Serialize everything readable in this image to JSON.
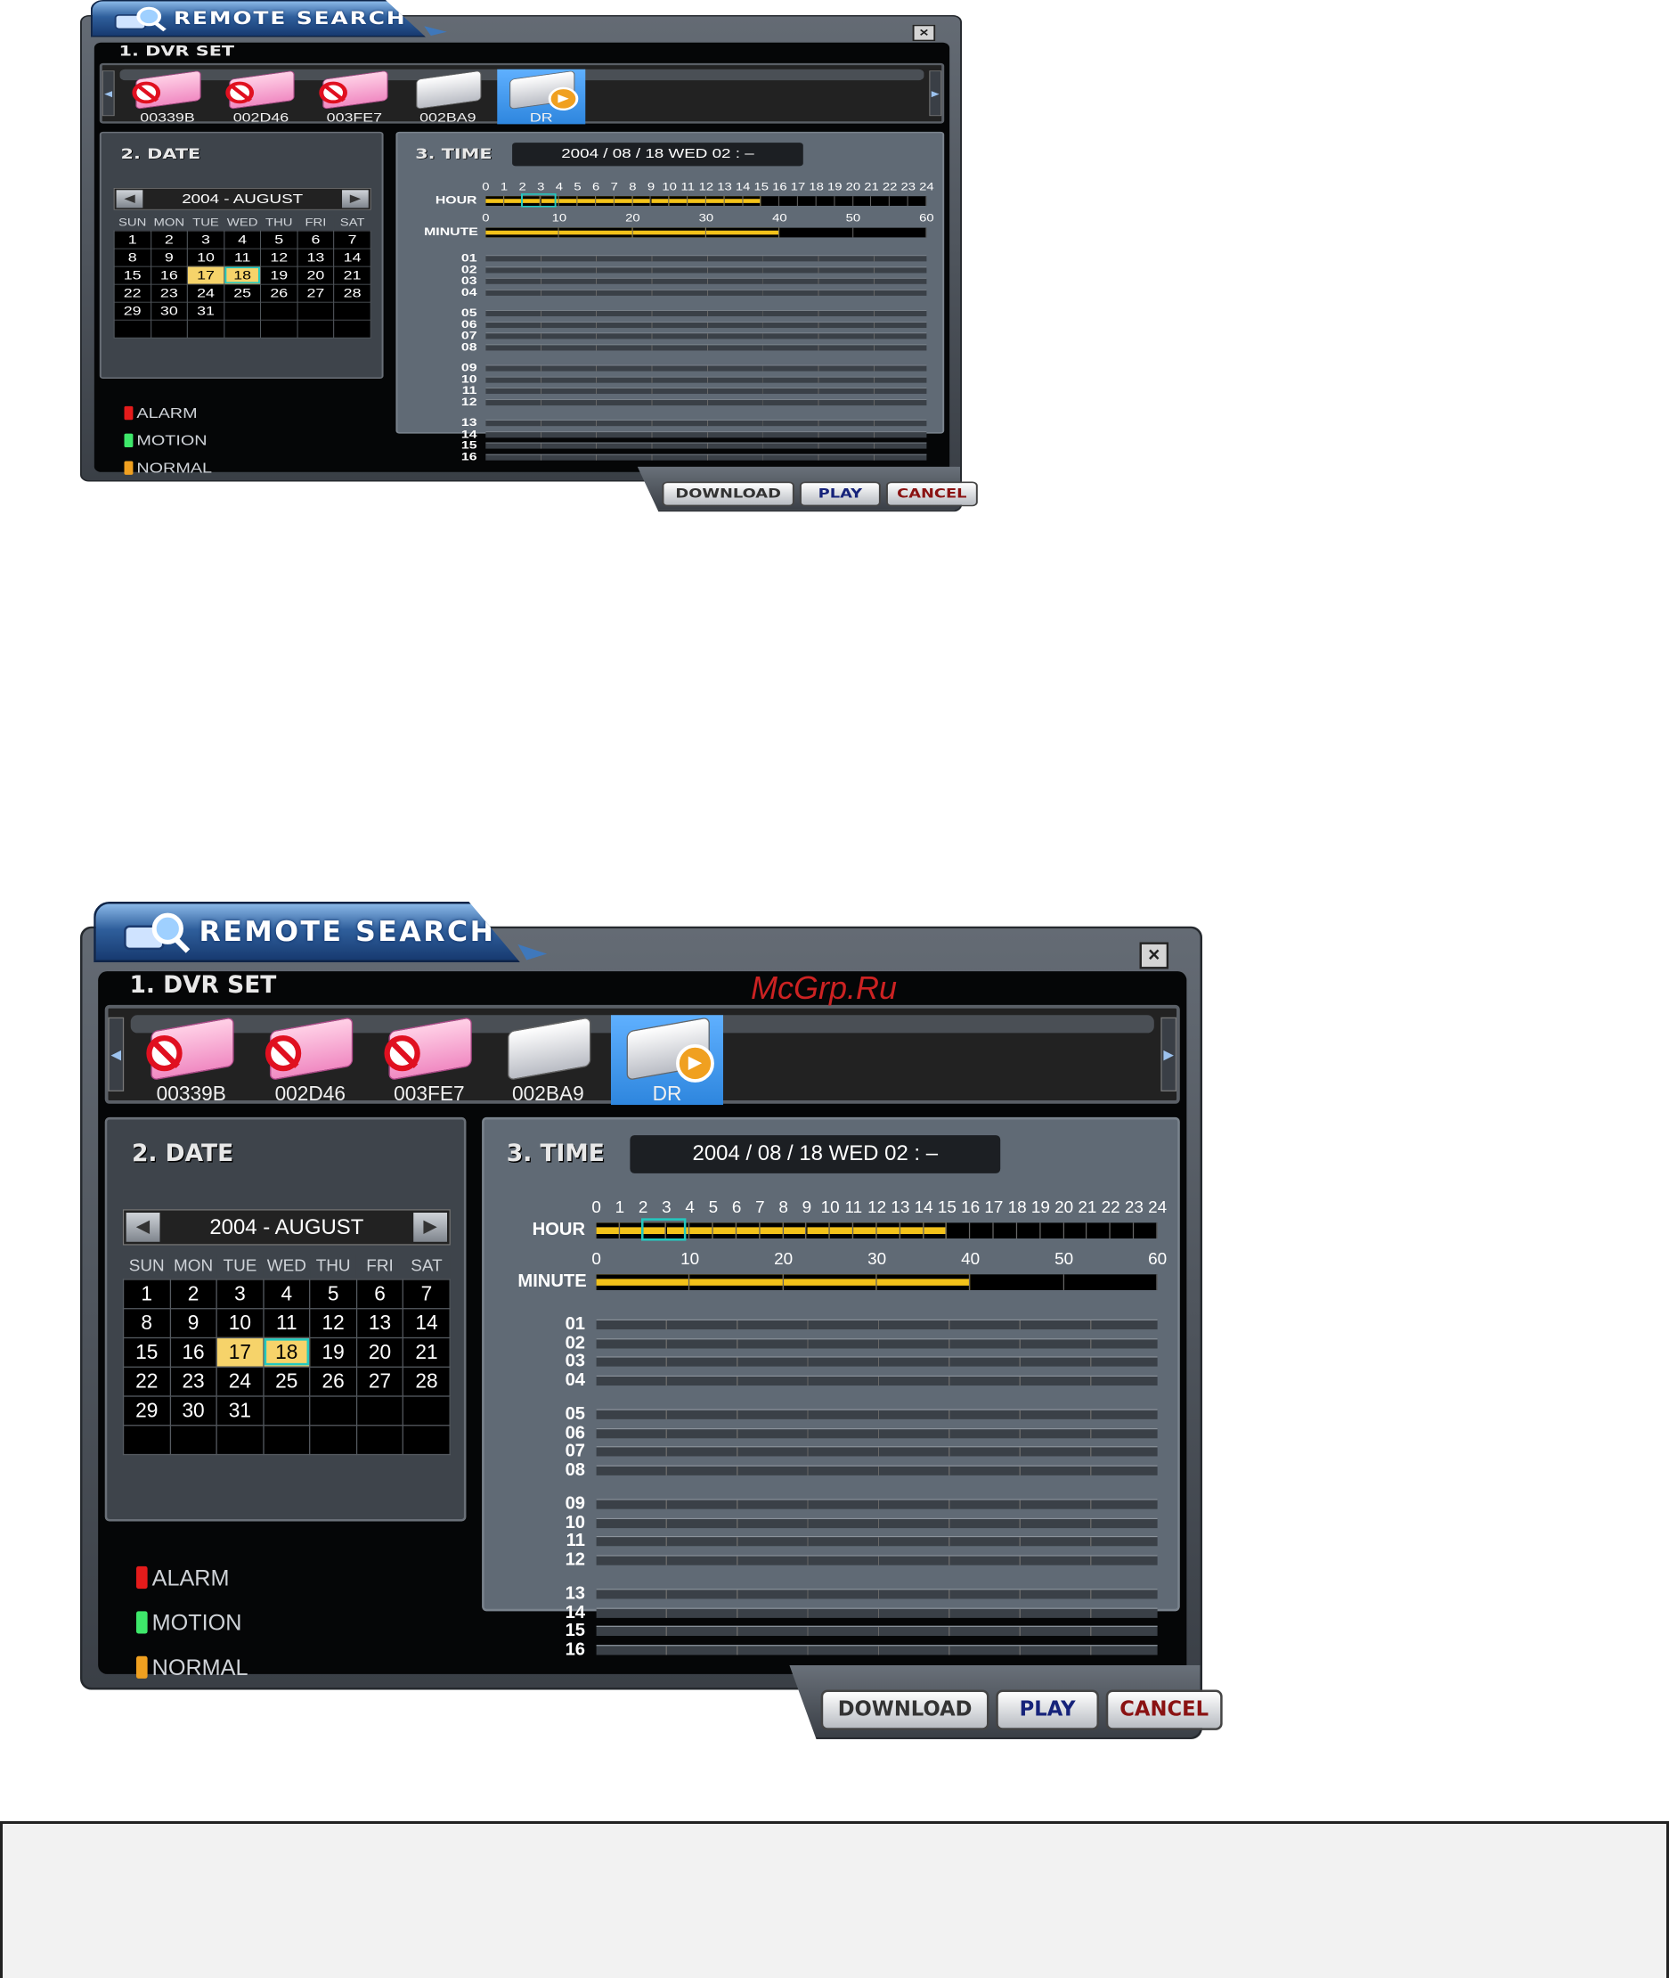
{
  "watermark": "McGrp.Ru",
  "screens": [
    {
      "title": "REMOTE SEARCH",
      "close_label": "×",
      "section_dvr": "1. DVR SET",
      "dvrs": [
        {
          "name": "00339B",
          "type": "disabled"
        },
        {
          "name": "002D46",
          "type": "disabled"
        },
        {
          "name": "003FE7",
          "type": "disabled"
        },
        {
          "name": "002BA9",
          "type": "normal"
        },
        {
          "name": "DR",
          "type": "selected"
        }
      ],
      "section_date": "2. DATE",
      "month_label": "2004 - AUGUST",
      "weekdays": [
        "SUN",
        "MON",
        "TUE",
        "WED",
        "THU",
        "FRI",
        "SAT"
      ],
      "calendar_rows": [
        [
          "1",
          "2",
          "3",
          "4",
          "5",
          "6",
          "7"
        ],
        [
          "8",
          "9",
          "10",
          "11",
          "12",
          "13",
          "14"
        ],
        [
          "15",
          "16",
          "17",
          "18",
          "19",
          "20",
          "21"
        ],
        [
          "22",
          "23",
          "24",
          "25",
          "26",
          "27",
          "28"
        ],
        [
          "29",
          "30",
          "31",
          "",
          "",
          "",
          ""
        ],
        [
          "",
          "",
          "",
          "",
          "",
          "",
          ""
        ]
      ],
      "highlighted_day": "17",
      "selected_day": "18",
      "legend": [
        {
          "label": "ALARM",
          "color": "#e41b1b"
        },
        {
          "label": "MOTION",
          "color": "#3ee86a"
        },
        {
          "label": "NORMAL",
          "color": "#f0a020"
        }
      ],
      "section_time": "3. TIME",
      "time_display": "2004 / 08 / 18 WED 02 : –",
      "hour_label": "HOUR",
      "hour_ticks": [
        "0",
        "1",
        "2",
        "3",
        "4",
        "5",
        "6",
        "7",
        "8",
        "9",
        "10",
        "11",
        "12",
        "13",
        "14",
        "15",
        "16",
        "17",
        "18",
        "19",
        "20",
        "21",
        "22",
        "23",
        "24"
      ],
      "hour_recorded_until": 15,
      "minute_label": "MINUTE",
      "minute_ticks": [
        "0",
        "10",
        "20",
        "30",
        "40",
        "50",
        "60"
      ],
      "minute_recorded_until": 40,
      "channels": [
        "01",
        "02",
        "03",
        "04",
        "05",
        "06",
        "07",
        "08",
        "09",
        "10",
        "11",
        "12",
        "13",
        "14",
        "15",
        "16"
      ],
      "buttons": {
        "download": "DOWNLOAD",
        "play": "PLAY",
        "cancel": "CANCEL"
      }
    }
  ]
}
